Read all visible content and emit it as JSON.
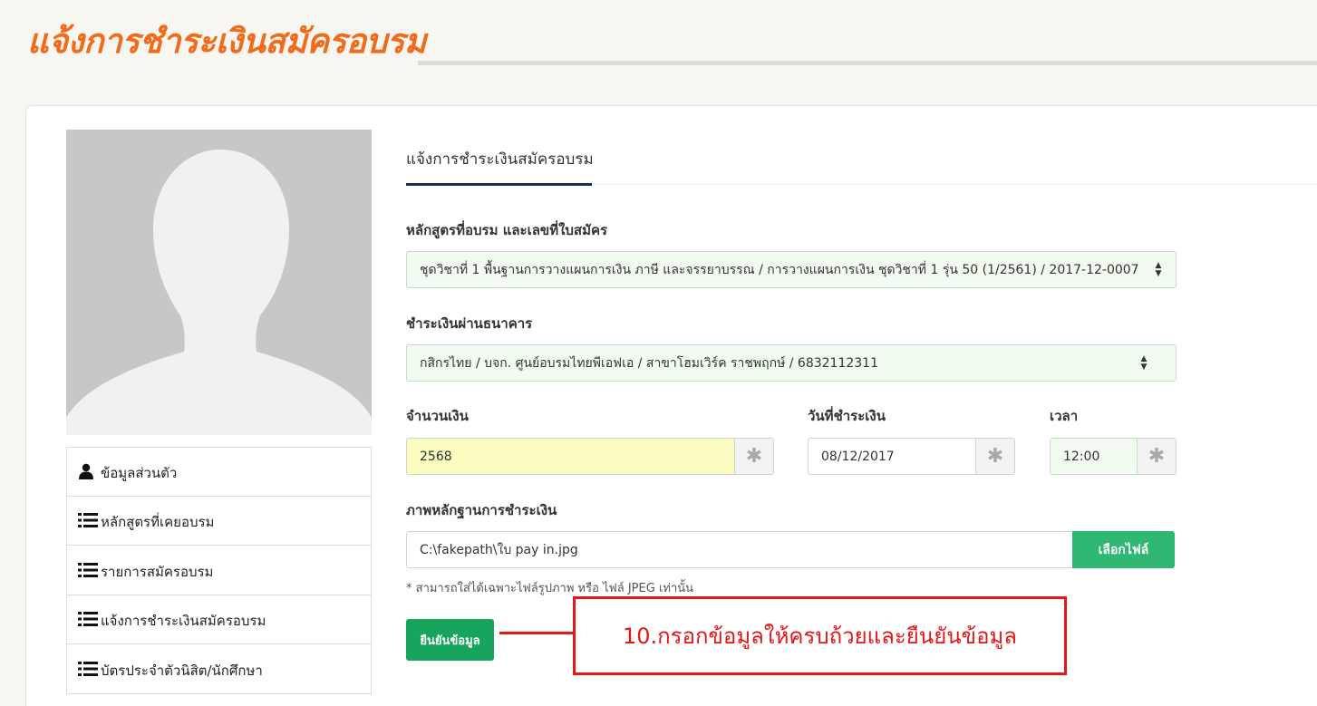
{
  "header": {
    "title": "แจ้งการชำระเงินสมัครอบรม"
  },
  "sidebar": {
    "items": [
      {
        "label": "ข้อมูลส่วนตัว",
        "icon": "user-icon"
      },
      {
        "label": "หลักสูตรที่เคยอบรม",
        "icon": "list-icon"
      },
      {
        "label": "รายการสมัครอบรม",
        "icon": "list-icon"
      },
      {
        "label": "แจ้งการชำระเงินสมัครอบรม",
        "icon": "list-icon"
      },
      {
        "label": "บัตรประจำตัวนิสิต/นักศึกษา",
        "icon": "list-icon"
      }
    ]
  },
  "tab": {
    "label": "แจ้งการชำระเงินสมัครอบรม"
  },
  "form": {
    "course": {
      "label": "หลักสูตรที่อบรม และเลขที่ใบสมัคร",
      "value": "ชุดวิชาที่ 1 พื้นฐานการวางแผนการเงิน ภาษี และจรรยาบรรณ / การวางแผนการเงิน ชุดวิชาที่ 1 รุ่น 50 (1/2561) / 2017-12-0007"
    },
    "bank": {
      "label": "ชำระเงินผ่านธนาคาร",
      "value": "กสิกรไทย / บจก. ศูนย์อบรมไทยพีเอฟเอ / สาขาโฮมเวิร์ค ราชพฤกษ์ / 6832112311"
    },
    "amount": {
      "label": "จำนวนเงิน",
      "value": "2568"
    },
    "date": {
      "label": "วันที่ชำระเงิน",
      "value": "08/12/2017"
    },
    "time": {
      "label": "เวลา",
      "value": "12:00"
    },
    "required_mark": "✱",
    "evidence": {
      "label": "ภาพหลักฐานการชำระเงิน",
      "value": "C:\\fakepath\\ใบ pay in.jpg",
      "button": "เลือกไฟล์"
    },
    "note": "* สามารถใส่ได้เฉพาะไฟล์รูปภาพ หรือ ไฟล์ JPEG เท่านั้น",
    "submit": "ยืนยันข้อมูล"
  },
  "annotation": {
    "text": "10.กรอกข้อมูลให้ครบถ้วยและยืนยันข้อมูล"
  },
  "colors": {
    "title": "#f26b1d",
    "primary_button": "#17a45d",
    "file_button": "#2fb871",
    "annotation": "#e41616",
    "amount_field": "#fbfcc0"
  }
}
